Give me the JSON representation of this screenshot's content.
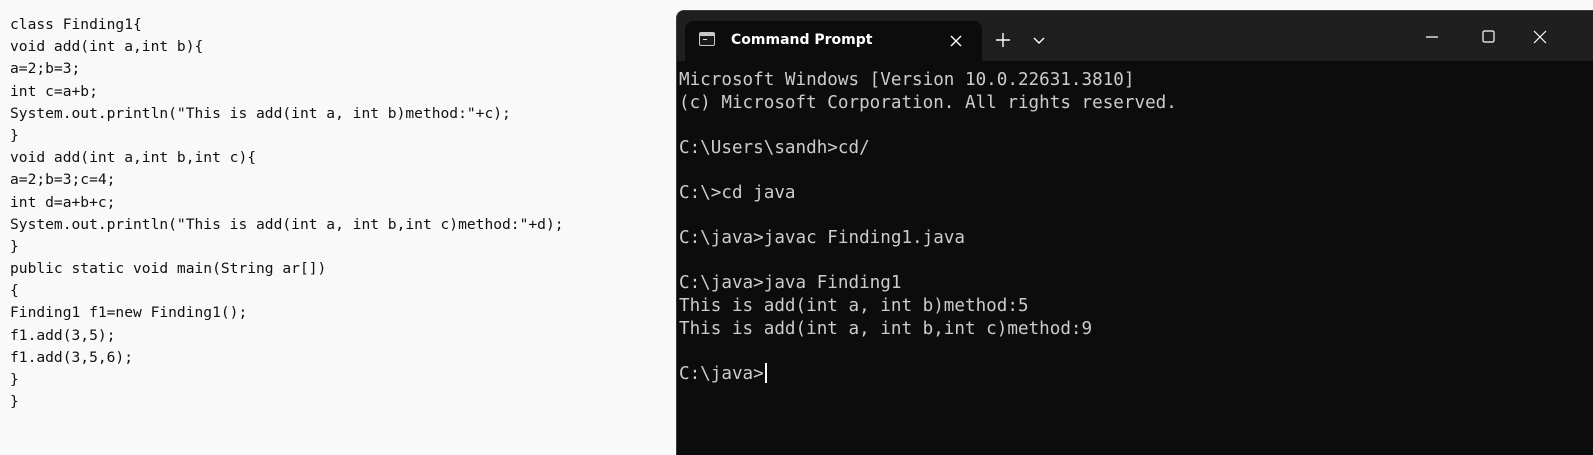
{
  "code_editor": {
    "lines": [
      "class Finding1{",
      "void add(int a,int b){",
      "a=2;b=3;",
      "int c=a+b;",
      "System.out.println(\"This is add(int a, int b)method:\"+c);",
      "}",
      "void add(int a,int b,int c){",
      "a=2;b=3;c=4;",
      "int d=a+b+c;",
      "System.out.println(\"This is add(int a, int b,int c)method:\"+d);",
      "}",
      "public static void main(String ar[])",
      "{",
      "Finding1 f1=new Finding1();",
      "f1.add(3,5);",
      "f1.add(3,5,6);",
      "}",
      "}"
    ]
  },
  "terminal": {
    "tab_title": "Command Prompt",
    "tab_icon": "terminal-icon",
    "icons": {
      "close_tab": "close-icon",
      "new_tab": "plus-icon",
      "dropdown": "chevron-down-icon",
      "minimize": "minimize-icon",
      "maximize": "maximize-icon",
      "close_window": "close-icon"
    },
    "output": [
      "Microsoft Windows [Version 10.0.22631.3810]",
      "(c) Microsoft Corporation. All rights reserved.",
      "",
      "C:\\Users\\sandh>cd/",
      "",
      "C:\\>cd java",
      "",
      "C:\\java>javac Finding1.java",
      "",
      "C:\\java>java Finding1",
      "This is add(int a, int b)method:5",
      "This is add(int a, int b,int c)method:9",
      ""
    ],
    "prompt": "C:\\java>",
    "input_value": ""
  },
  "colors": {
    "terminal_bg": "#0c0c0c",
    "titlebar_bg": "#1f1f1f",
    "terminal_text": "#cccccc",
    "editor_bg": "#f9f9f9",
    "editor_text": "#111111"
  }
}
